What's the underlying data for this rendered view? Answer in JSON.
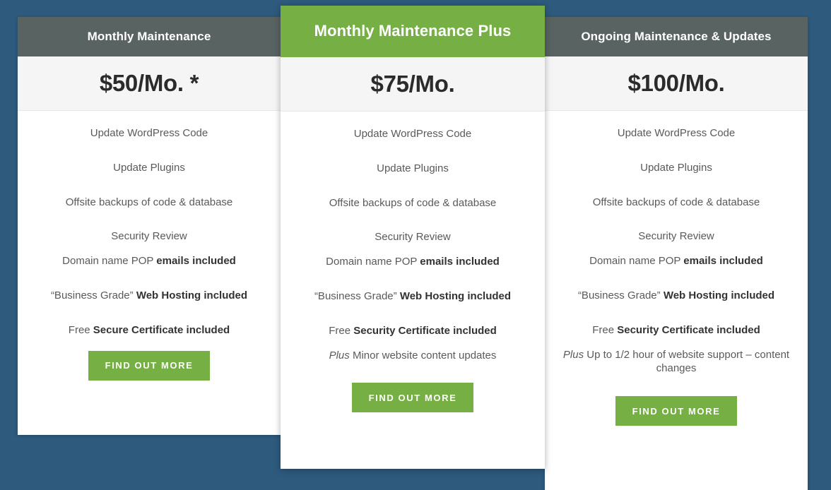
{
  "theme": {
    "page_background": "#2e5a7d",
    "header_plain": "#596362",
    "header_accent": "#76b044",
    "price_band": "#f5f5f5",
    "button": "#76b044",
    "card_background": "#ffffff"
  },
  "plans": [
    {
      "title": "Monthly Maintenance",
      "price": "$50/Mo. *",
      "featured": false,
      "features_primary": [
        "Update WordPress Code",
        "Update Plugins",
        "Offsite backups of code & database",
        "Security Review"
      ],
      "features_secondary": [
        {
          "plain_before": "Domain name POP ",
          "bold": "emails included",
          "plain_after": ""
        },
        {
          "plain_before": "“Business Grade” ",
          "bold": "Web Hosting included",
          "plain_after": ""
        },
        {
          "plain_before": "Free ",
          "bold": "Secure Certificate included",
          "plain_after": ""
        }
      ],
      "plus_line": null,
      "cta_label": "Find Out More"
    },
    {
      "title": "Monthly Maintenance Plus",
      "price": "$75/Mo.",
      "featured": true,
      "features_primary": [
        "Update WordPress Code",
        "Update Plugins",
        "Offsite backups of code & database",
        "Security Review"
      ],
      "features_secondary": [
        {
          "plain_before": "Domain name POP ",
          "bold": "emails included",
          "plain_after": ""
        },
        {
          "plain_before": "“Business Grade” ",
          "bold": "Web Hosting included",
          "plain_after": ""
        },
        {
          "plain_before": "Free ",
          "bold": "Security Certificate included",
          "plain_after": ""
        }
      ],
      "plus_line": {
        "italic": "Plus",
        "plain": " Minor website content updates"
      },
      "cta_label": "Find Out More"
    },
    {
      "title": "Ongoing Maintenance & Updates",
      "price": "$100/Mo.",
      "featured": false,
      "features_primary": [
        "Update WordPress Code",
        "Update Plugins",
        "Offsite backups of code & database",
        "Security Review"
      ],
      "features_secondary": [
        {
          "plain_before": "Domain name POP ",
          "bold": "emails included",
          "plain_after": ""
        },
        {
          "plain_before": "“Business Grade” ",
          "bold": "Web Hosting included",
          "plain_after": ""
        },
        {
          "plain_before": "Free ",
          "bold": "Security Certificate included",
          "plain_after": ""
        }
      ],
      "plus_line": {
        "italic": "Plus",
        "plain": " Up to 1/2 hour of website support – content changes"
      },
      "cta_label": "Find Out More"
    }
  ]
}
